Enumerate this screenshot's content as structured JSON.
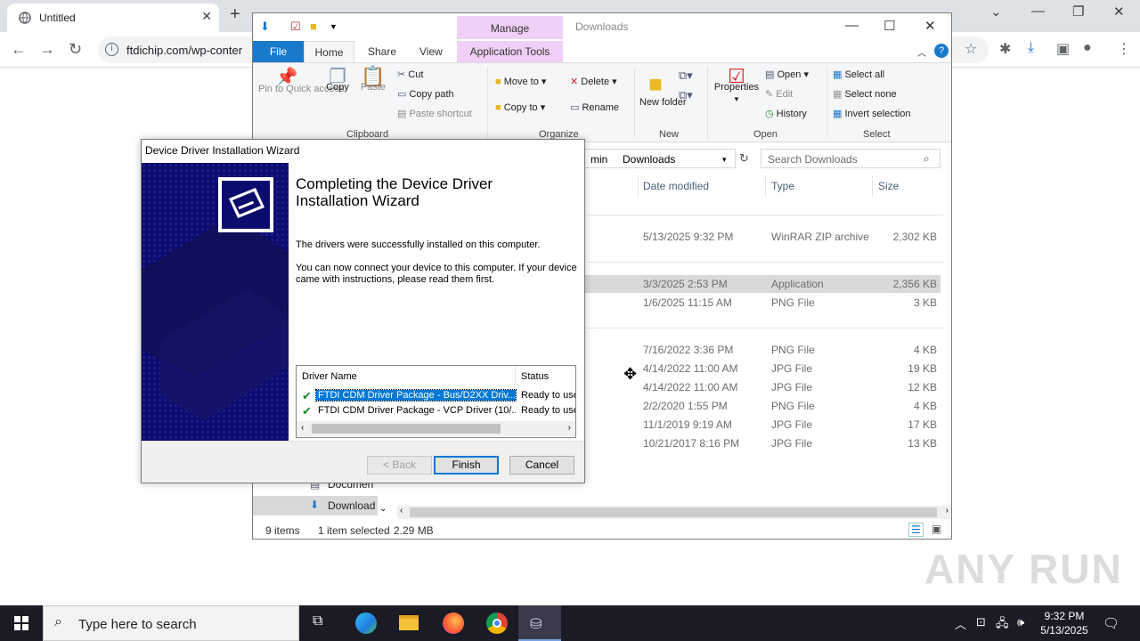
{
  "browser": {
    "tab_title": "Untitled",
    "url": "ftdichip.com/wp-conter"
  },
  "explorer": {
    "title": "Downloads",
    "contextual_tab_group": "Manage",
    "ribbon_tabs": [
      "File",
      "Home",
      "Share",
      "View",
      "Application Tools"
    ],
    "clipboard": {
      "label": "Clipboard",
      "pin": "Pin to Quick access",
      "copy": "Copy",
      "paste": "Paste",
      "cut": "Cut",
      "copy_path": "Copy path",
      "paste_shortcut": "Paste shortcut"
    },
    "organize": {
      "label": "Organize",
      "move_to": "Move to",
      "copy_to": "Copy to",
      "delete": "Delete",
      "rename": "Rename"
    },
    "new": {
      "label": "New",
      "new_folder": "New folder"
    },
    "open": {
      "label": "Open",
      "properties": "Properties",
      "open": "Open",
      "edit": "Edit",
      "history": "History"
    },
    "select": {
      "label": "Select",
      "select_all": "Select all",
      "select_none": "Select none",
      "invert": "Invert selection"
    },
    "address": {
      "prefix": "min",
      "current": "Downloads"
    },
    "search_placeholder": "Search Downloads",
    "columns": [
      "Date modified",
      "Type",
      "Size"
    ],
    "rows": [
      {
        "date": "5/13/2025 9:32 PM",
        "type": "WinRAR ZIP archive",
        "size": "2,302 KB"
      },
      {
        "date": "3/3/2025 2:53 PM",
        "type": "Application",
        "size": "2,356 KB"
      },
      {
        "date": "1/6/2025 11:15 AM",
        "type": "PNG File",
        "size": "3 KB"
      },
      {
        "date": "7/16/2022 3:36 PM",
        "type": "PNG File",
        "size": "4 KB"
      },
      {
        "date": "4/14/2022 11:00 AM",
        "type": "JPG File",
        "size": "19 KB"
      },
      {
        "date": "4/14/2022 11:00 AM",
        "type": "JPG File",
        "size": "12 KB"
      },
      {
        "date": "2/2/2020 1:55 PM",
        "type": "PNG File",
        "size": "4 KB"
      },
      {
        "date": "11/1/2019 9:19 AM",
        "type": "JPG File",
        "size": "17 KB"
      },
      {
        "date": "10/21/2017 8:16 PM",
        "type": "JPG File",
        "size": "13 KB"
      }
    ],
    "nav": {
      "documents": "Documen",
      "downloads": "Download"
    },
    "status": {
      "items": "9 items",
      "selected": "1 item selected",
      "size": "2.29 MB"
    }
  },
  "wizard": {
    "title": "Device Driver Installation Wizard",
    "heading": "Completing the Device Driver Installation Wizard",
    "para1": "The drivers were successfully installed on this computer.",
    "para2": "You can now connect your device to this computer. If your device came with instructions, please read them first.",
    "list_headers": [
      "Driver Name",
      "Status"
    ],
    "drivers": [
      {
        "name": "FTDI CDM Driver Package - Bus/D2XX Driv...",
        "status": "Ready to use"
      },
      {
        "name": "FTDI CDM Driver Package - VCP Driver (10/...",
        "status": "Ready to use"
      }
    ],
    "buttons": {
      "back": "< Back",
      "finish": "Finish",
      "cancel": "Cancel"
    }
  },
  "taskbar": {
    "search_placeholder": "Type here to search",
    "time": "9:32 PM",
    "date": "5/13/2025"
  },
  "watermark": "ANY RUN",
  "colors": {
    "accent": "#0078d7",
    "file_tab": "#1979ca",
    "manage_band": "#f0d0f6",
    "wizard_banner": "#0c0c6e",
    "taskbar": "#1b1b26"
  }
}
